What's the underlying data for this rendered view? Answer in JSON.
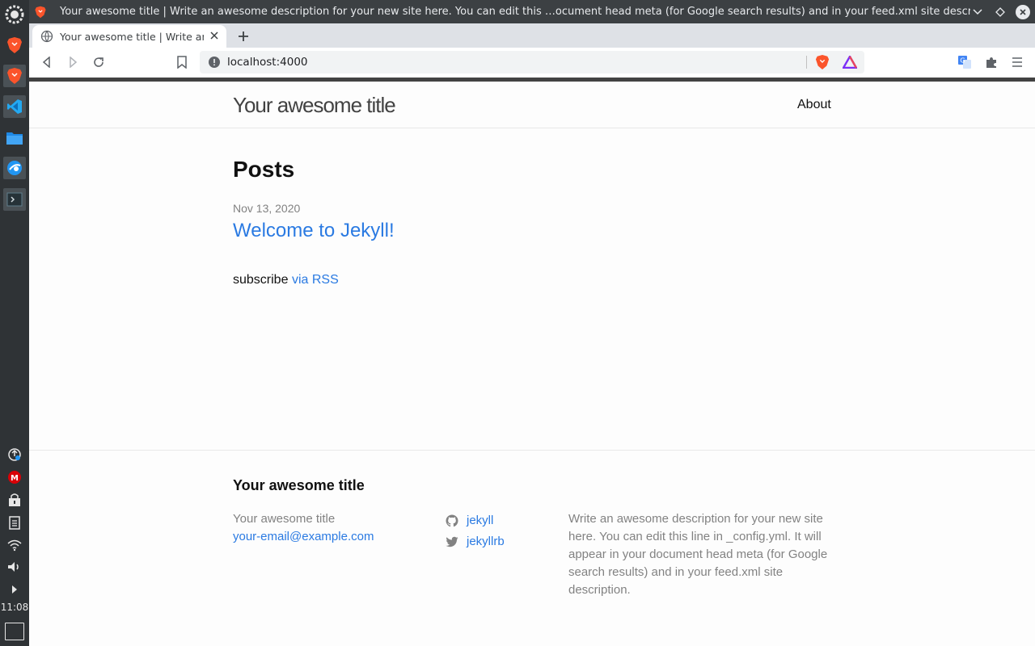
{
  "dock": {
    "items": [
      {
        "name": "system-menu-icon"
      },
      {
        "name": "brave-browser-icon"
      },
      {
        "name": "brave-browser-icon"
      },
      {
        "name": "vscode-icon"
      },
      {
        "name": "file-manager-icon"
      },
      {
        "name": "web-browser-icon"
      },
      {
        "name": "terminal-icon"
      }
    ],
    "tray": [
      {
        "name": "update-icon"
      },
      {
        "name": "mega-icon"
      },
      {
        "name": "vault-icon"
      },
      {
        "name": "clipboard-icon"
      },
      {
        "name": "wifi-icon"
      },
      {
        "name": "volume-icon"
      },
      {
        "name": "expand-tray-icon"
      }
    ],
    "clock": "11:08"
  },
  "window": {
    "title": "Your awesome title | Write an awesome description for your new site here. You can edit this …ocument head meta (for Google search results) and in your feed.xml site description. - Brave"
  },
  "tabs": [
    {
      "title": "Your awesome title | Write an awesome description for your new site here."
    }
  ],
  "toolbar": {
    "url": "localhost:4000"
  },
  "site": {
    "title": "Your awesome title",
    "nav": [
      "About"
    ],
    "heading": "Posts",
    "posts": [
      {
        "date": "Nov 13, 2020",
        "title": "Welcome to Jekyll!"
      }
    ],
    "subscribe_text": "subscribe",
    "rss_link": "via RSS"
  },
  "footer": {
    "heading": "Your awesome title",
    "name": "Your awesome title",
    "email": "your-email@example.com",
    "social": [
      {
        "icon": "github-icon",
        "label": "jekyll"
      },
      {
        "icon": "twitter-icon",
        "label": "jekyllrb"
      }
    ],
    "description": "Write an awesome description for your new site here. You can edit this line in _config.yml. It will appear in your document head meta (for Google search results) and in your feed.xml site description."
  },
  "colors": {
    "link": "#2a7ae2",
    "meta": "#828282",
    "text": "#111111"
  }
}
